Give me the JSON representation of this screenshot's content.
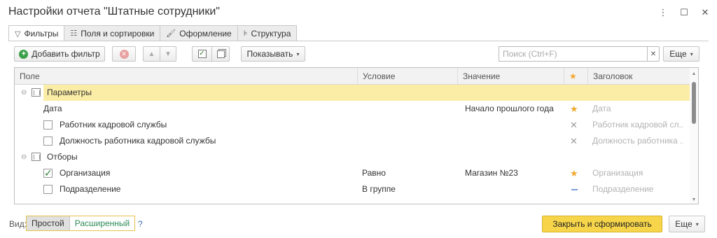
{
  "window": {
    "title": "Настройки отчета \"Штатные сотрудники\"",
    "controls": [
      "more-icon",
      "maximize-icon",
      "close-icon"
    ]
  },
  "tabs": [
    {
      "label": "Фильтры",
      "icon": "filter-icon",
      "active": true
    },
    {
      "label": "Поля и сортировки",
      "icon": "columns-icon",
      "active": false
    },
    {
      "label": "Оформление",
      "icon": "brush-icon",
      "active": false
    },
    {
      "label": "Структура",
      "icon": "structure-icon",
      "active": false
    }
  ],
  "toolbar": {
    "add_filter": "Добавить фильтр",
    "show": "Показывать",
    "search_placeholder": "Поиск (Ctrl+F)",
    "search_value": "",
    "more": "Еще"
  },
  "table": {
    "columns": [
      "Поле",
      "Условие",
      "Значение",
      "★",
      "Заголовок"
    ],
    "rows": [
      {
        "type": "group",
        "label": "Параметры",
        "selected": true
      },
      {
        "type": "item",
        "label": "Дата",
        "checkbox": null,
        "condition": "",
        "value": "Начало прошлого года",
        "mark": "star",
        "caption": "Дата"
      },
      {
        "type": "item",
        "label": "Работник кадровой службы",
        "checkbox": false,
        "condition": "",
        "value": "",
        "mark": "x",
        "caption": "Работник кадровой сл..."
      },
      {
        "type": "item",
        "label": "Должность работника кадровой службы",
        "checkbox": false,
        "condition": "",
        "value": "",
        "mark": "x",
        "caption": "Должность работника ..."
      },
      {
        "type": "group",
        "label": "Отборы",
        "selected": false
      },
      {
        "type": "item",
        "label": "Организация",
        "checkbox": true,
        "condition": "Равно",
        "value": "Магазин №23",
        "mark": "star",
        "caption": "Организация"
      },
      {
        "type": "item",
        "label": "Подразделение",
        "checkbox": false,
        "condition": "В группе",
        "value": "",
        "mark": "dash",
        "caption": "Подразделение"
      }
    ]
  },
  "footer": {
    "view_label": "Вид:",
    "view_simple": "Простой",
    "view_advanced": "Расширенный",
    "help": "?",
    "submit": "Закрыть и сформировать",
    "more": "Еще"
  },
  "colors": {
    "accent_yellow": "#f7d54a",
    "selection": "#fbeda5",
    "star": "#f0a830",
    "check_green": "#2e7d32"
  }
}
